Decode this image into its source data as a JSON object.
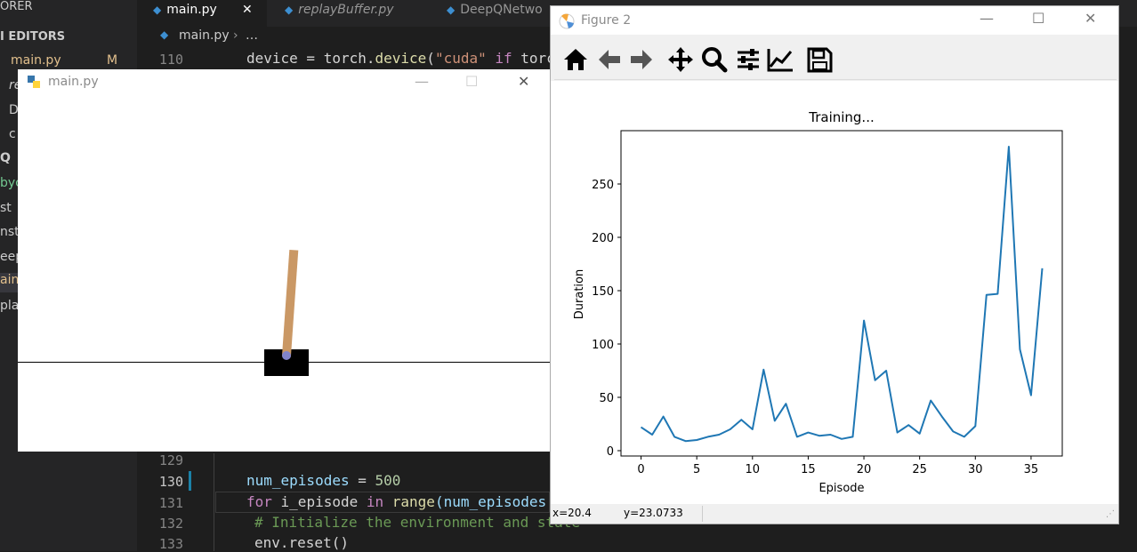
{
  "vscode": {
    "sidebar": {
      "header": "ORER",
      "section": "I EDITORS",
      "open_editor": "main.py",
      "open_editor_badge": "M",
      "items": [
        "re",
        "D",
        "c",
        "Q",
        "byc",
        "st",
        "nst",
        "eep",
        "ain",
        "pla"
      ]
    },
    "tabs": [
      {
        "label": "main.py",
        "close": "✕"
      },
      {
        "label": "replayBuffer.py"
      },
      {
        "label": "DeepQNetwo"
      }
    ],
    "breadcrumb": {
      "file": "main.py",
      "rest": "…"
    },
    "lines_top": [
      {
        "num": "110",
        "code": "device = torch.device(\"cuda\" if torc"
      }
    ],
    "lines_bottom": [
      {
        "num": "129"
      },
      {
        "num": "130"
      },
      {
        "num": "131"
      },
      {
        "num": "132"
      },
      {
        "num": "133"
      }
    ],
    "code": {
      "l130_a": "num_episodes",
      "l130_b": " = ",
      "l130_c": "500",
      "l131_a": "for",
      "l131_b": " i_episode ",
      "l131_c": "in",
      "l131_d": " range",
      "l131_e": "(num_episodes",
      "l132": "# Initialize the environment and state",
      "l133": "env.reset()",
      "l110_a": "device = torch.",
      "l110_b": "device",
      "l110_c": "(",
      "l110_d": "\"cuda\"",
      "l110_e": " if",
      "l110_f": " torc"
    }
  },
  "pygame_window": {
    "title": "main.py",
    "minimize": "—",
    "maximize": "☐",
    "close": "✕",
    "pole_angle_deg": 4
  },
  "figure_window": {
    "title": "Figure 2",
    "minimize": "—",
    "maximize": "☐",
    "close": "✕",
    "toolbar": [
      "home-icon",
      "back-icon",
      "forward-icon",
      "pan-icon",
      "zoom-icon",
      "subplots-icon",
      "customize-icon",
      "save-icon"
    ],
    "status": {
      "x": "x=20.4",
      "y": "y=23.0733"
    }
  },
  "chart_data": {
    "type": "line",
    "title": "Training...",
    "xlabel": "Episode",
    "ylabel": "Duration",
    "xlim": [
      -1.8,
      37.8
    ],
    "ylim": [
      -5,
      300
    ],
    "xticks": [
      0,
      5,
      10,
      15,
      20,
      25,
      30,
      35
    ],
    "yticks": [
      0,
      50,
      100,
      150,
      200,
      250
    ],
    "color": "#1f77b4",
    "series": [
      {
        "x": [
          0,
          1,
          2,
          3,
          4,
          5,
          6,
          7,
          8,
          9,
          10,
          11,
          12,
          13,
          14,
          15,
          16,
          17,
          18,
          19,
          20,
          21,
          22,
          23,
          24,
          25,
          26,
          27,
          28,
          29,
          30,
          31,
          32,
          33,
          34,
          35,
          36
        ],
        "values": [
          22,
          15,
          32,
          13,
          9,
          10,
          13,
          15,
          20,
          29,
          20,
          76,
          28,
          44,
          13,
          17,
          14,
          15,
          11,
          13,
          122,
          66,
          75,
          17,
          24,
          16,
          47,
          32,
          18,
          13,
          23,
          146,
          147,
          285,
          95,
          52,
          171
        ]
      }
    ]
  }
}
